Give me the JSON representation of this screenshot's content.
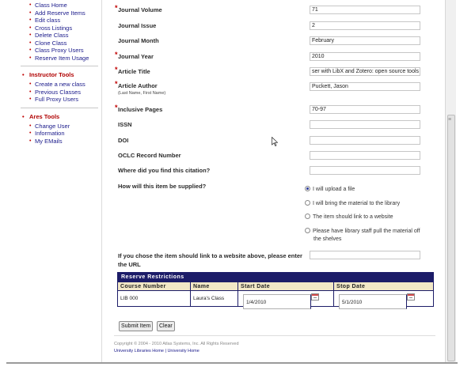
{
  "sidebar": {
    "class_items": [
      "Class Home",
      "Add Reserve Items",
      "Edit class",
      "Cross Listings",
      "Delete Class",
      "Clone Class",
      "Class Proxy Users",
      "Reserve Item Usage"
    ],
    "instructor_title": "Instructor Tools",
    "instructor_items": [
      "Create a new class",
      "Previous Classes",
      "Full Proxy Users"
    ],
    "ares_title": "Ares Tools",
    "ares_items": [
      "Change User",
      "Information",
      "My EMails"
    ]
  },
  "form": {
    "journal_volume": {
      "label": "Journal Volume",
      "value": "71"
    },
    "journal_issue": {
      "label": "Journal Issue",
      "value": "2"
    },
    "journal_month": {
      "label": "Journal Month",
      "value": "February"
    },
    "journal_year": {
      "label": "Journal Year",
      "value": "2010"
    },
    "article_title": {
      "label": "Article Title",
      "value": "ser with LibX and Zotero: open source tools"
    },
    "article_author": {
      "label": "Article Author",
      "sublabel": "(Last Name, First Name)",
      "value": "Puckett, Jason"
    },
    "inclusive_pages": {
      "label": "Inclusive Pages",
      "value": "70-97"
    },
    "issn": {
      "label": "ISSN",
      "value": ""
    },
    "doi": {
      "label": "DOI",
      "value": ""
    },
    "oclc": {
      "label": "OCLC Record Number",
      "value": ""
    },
    "where_found": {
      "label": "Where did you find this citation?",
      "value": ""
    },
    "supplied": {
      "label": "How will this item be supplied?",
      "options": [
        {
          "label": "I will upload a file",
          "checked": true
        },
        {
          "label": "I will bring the material to the library",
          "checked": false
        },
        {
          "label": "The item should link to a website",
          "checked": false
        },
        {
          "label": "Please have library staff pull the material off",
          "label2": "the shelves",
          "checked": false
        }
      ]
    },
    "url": {
      "label": "If you chose the item should link to a website above, please enter",
      "label2": "the URL",
      "value": ""
    }
  },
  "reserve": {
    "title": "Reserve Restrictions",
    "headers": [
      "Course Number",
      "Name",
      "Start Date",
      "Stop Date"
    ],
    "row": {
      "course": "LIB 000",
      "name": "Laura's Class",
      "start": "1/4/2010",
      "stop": "5/1/2010"
    }
  },
  "buttons": {
    "submit": "Submit Item",
    "clear": "Clear"
  },
  "footer": {
    "copyright": "Copyright © 2004 - 2010 Atlas Systems, Inc. All Rights Reserved",
    "links": "University Libraries Home | University Home"
  },
  "colors": {
    "accent": "#1c1c68",
    "section_red": "#b00000",
    "header_tan": "#f1e7c6"
  }
}
